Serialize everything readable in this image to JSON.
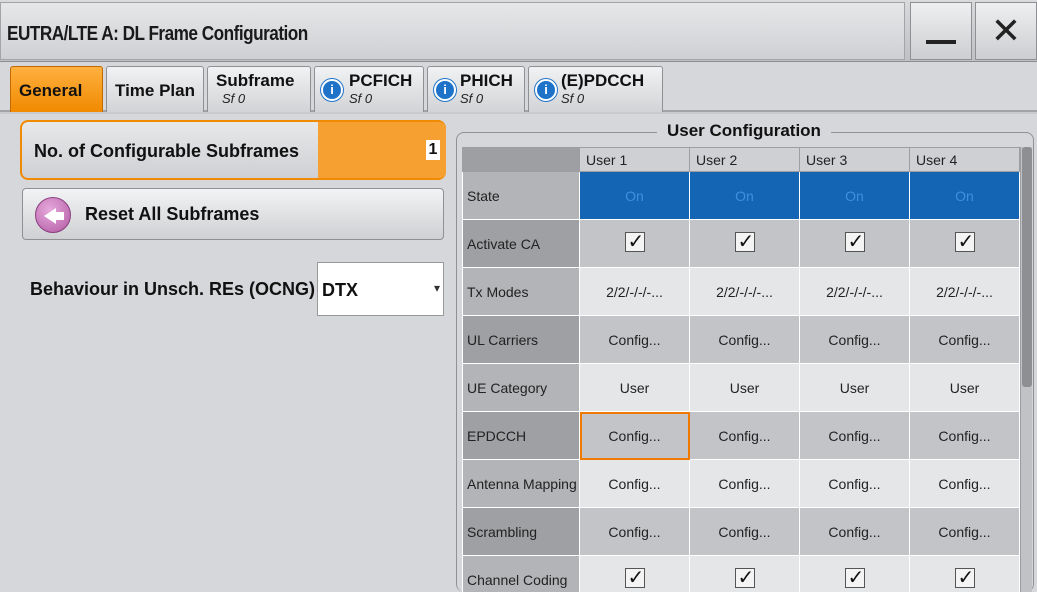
{
  "window": {
    "title": "EUTRA/LTE A: DL Frame Configuration"
  },
  "tabs": [
    {
      "label": "General",
      "sub": "",
      "info": false,
      "active": true
    },
    {
      "label": "Time Plan",
      "sub": "",
      "info": false,
      "active": false
    },
    {
      "label": "Subframe",
      "sub": "Sf 0",
      "info": false,
      "active": false
    },
    {
      "label": "PCFICH",
      "sub": "Sf 0",
      "info": true,
      "active": false
    },
    {
      "label": "PHICH",
      "sub": "Sf 0",
      "info": true,
      "active": false
    },
    {
      "label": "(E)PDCCH",
      "sub": "Sf 0",
      "info": true,
      "active": false
    }
  ],
  "general": {
    "subframes_label": "No. of Configurable Subframes",
    "subframes_value": "1",
    "reset_label": "Reset All Subframes",
    "ocng_label": "Behaviour in Unsch. REs (OCNG)",
    "ocng_value": "DTX"
  },
  "user_config": {
    "title": "User Configuration",
    "columns": [
      "User 1",
      "User 2",
      "User 3",
      "User 4"
    ],
    "rows": [
      {
        "label": "State",
        "type": "on",
        "values": [
          "On",
          "On",
          "On",
          "On"
        ]
      },
      {
        "label": "Activate CA",
        "type": "check",
        "values": [
          "checked",
          "checked",
          "checked",
          "checked"
        ]
      },
      {
        "label": "Tx Modes",
        "type": "text",
        "values": [
          "2/2/-/-/-...",
          "2/2/-/-/-...",
          "2/2/-/-/-...",
          "2/2/-/-/-..."
        ]
      },
      {
        "label": "UL Carriers",
        "type": "text",
        "values": [
          "Config...",
          "Config...",
          "Config...",
          "Config..."
        ]
      },
      {
        "label": "UE Category",
        "type": "text",
        "values": [
          "User",
          "User",
          "User",
          "User"
        ]
      },
      {
        "label": "EPDCCH",
        "type": "text",
        "values": [
          "Config...",
          "Config...",
          "Config...",
          "Config..."
        ]
      },
      {
        "label": "Antenna Mapping",
        "type": "text",
        "values": [
          "Config...",
          "Config...",
          "Config...",
          "Config..."
        ]
      },
      {
        "label": "Scrambling",
        "type": "text",
        "values": [
          "Config...",
          "Config...",
          "Config...",
          "Config..."
        ]
      },
      {
        "label": "Channel Coding",
        "type": "check",
        "values": [
          "checked",
          "checked",
          "checked",
          "checked"
        ]
      }
    ]
  },
  "icons": {
    "minimize": "minimize-icon",
    "close": "close-icon",
    "info": "info-icon",
    "reset": "reset-arrow-icon"
  },
  "colors": {
    "accent": "#f08a00",
    "state_on": "#1565b5",
    "info": "#1e73c8"
  }
}
